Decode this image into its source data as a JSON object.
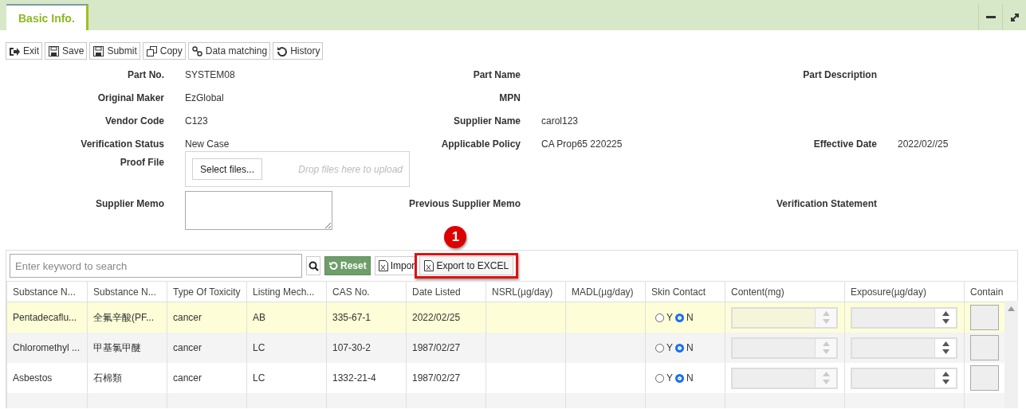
{
  "tabs": [
    {
      "label": "Basic Info.",
      "selected": true
    }
  ],
  "toolbar": [
    {
      "label": "Exit",
      "kind": "exit"
    },
    {
      "label": "Save",
      "kind": "save"
    },
    {
      "label": "Submit",
      "kind": "save"
    },
    {
      "label": "Copy",
      "kind": "copy"
    },
    {
      "label": "Data matching",
      "kind": "link"
    },
    {
      "label": "History",
      "kind": "history"
    }
  ],
  "form": [
    [
      {
        "kind": "text",
        "label": "Part No.",
        "value": "SYSTEM08"
      },
      {
        "kind": "text",
        "label": "Part Name"
      },
      {
        "kind": "text",
        "label": "Part Description"
      }
    ],
    [
      {
        "kind": "text",
        "label": "Original Maker",
        "value": "EzGlobal"
      },
      {
        "kind": "text",
        "label": "MPN"
      },
      {
        "kind": "empty"
      }
    ],
    [
      {
        "kind": "text",
        "label": "Vendor Code",
        "value": "C123"
      },
      {
        "kind": "text",
        "label": "Supplier Name",
        "value": "carol123"
      },
      {
        "kind": "empty"
      }
    ],
    [
      {
        "kind": "text",
        "label": "Verification Status",
        "value": "New Case"
      },
      {
        "kind": "text",
        "label": "Applicable Policy",
        "value": "CA Prop65 220225"
      },
      {
        "kind": "text",
        "label": "Effective Date",
        "value": "2022/02//25"
      }
    ],
    [
      {
        "kind": "upload",
        "label": "Proof File",
        "button": "Select files...",
        "hint": "Drop files here to upload"
      },
      {
        "kind": "empty"
      },
      {
        "kind": "empty"
      }
    ],
    [
      {
        "kind": "textarea",
        "label": "Supplier Memo"
      },
      {
        "kind": "text",
        "label": "Previous Supplier Memo"
      },
      {
        "kind": "text",
        "label": "Verification Statement"
      }
    ]
  ],
  "grid": {
    "search": {
      "placeholder": "Enter keyword to search"
    },
    "buttons": [
      {
        "label": "Reset",
        "kind": "reset",
        "highlighted": false
      },
      {
        "label": "Impor",
        "kind": "import",
        "highlighted": false
      },
      {
        "label": "Export to EXCEL",
        "kind": "import",
        "highlighted": true
      }
    ],
    "annotation": {
      "label": "1"
    },
    "columns": [
      "Substance N...",
      "Substance N...",
      "Type Of Toxicity",
      "Listing Mech...",
      "CAS No.",
      "Date Listed",
      "NSRL(µg/day)",
      "MADL(µg/day)",
      "Skin Contact",
      "Content(mg)",
      "Exposure(µg/day)",
      "Contain"
    ],
    "rows": [
      {
        "selected": true,
        "cells": [
          "Pentadecaflu...",
          "全氟辛酸(PF...",
          "cancer",
          "AB",
          "335-67-1",
          "2022/02/25"
        ],
        "skin": [
          {
            "label": "Y",
            "selected": false
          },
          {
            "label": "N",
            "selected": true
          }
        ],
        "content_disabled": true,
        "exposure_disabled": false
      },
      {
        "selected": false,
        "cells": [
          "Chloromethyl ...",
          "甲基氯甲醚",
          "cancer",
          "LC",
          "107-30-2",
          "1987/02/27"
        ],
        "skin": [
          {
            "label": "Y",
            "selected": false
          },
          {
            "label": "N",
            "selected": true
          }
        ],
        "content_disabled": true,
        "exposure_disabled": false
      },
      {
        "selected": false,
        "cells": [
          "Asbestos",
          "石棉類",
          "cancer",
          "LC",
          "1332-21-4",
          "1987/02/27"
        ],
        "skin": [
          {
            "label": "Y",
            "selected": false
          },
          {
            "label": "N",
            "selected": true
          }
        ],
        "content_disabled": true,
        "exposure_disabled": false
      }
    ]
  }
}
